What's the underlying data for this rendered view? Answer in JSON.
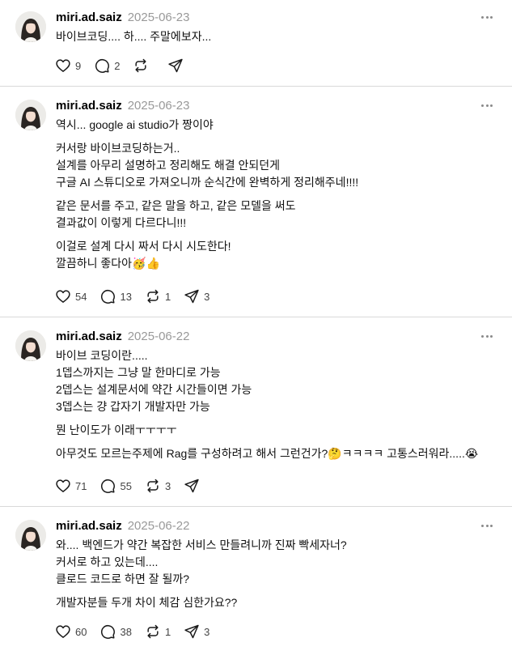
{
  "posts": [
    {
      "username": "miri.ad.saiz",
      "date": "2025-06-23",
      "paragraphs": [
        "바이브코딩.... 하.... 주말에보자..."
      ],
      "likes": "9",
      "replies": "2",
      "reposts": "",
      "shares": ""
    },
    {
      "username": "miri.ad.saiz",
      "date": "2025-06-23",
      "paragraphs": [
        "역시... google ai studio가 짱이야",
        "커서랑 바이브코딩하는거..\n설계를 아무리 설명하고 정리해도 해결 안되던게\n구글 AI 스튜디오로 가져오니까 순식간에 완벽하게 정리해주네!!!!",
        "같은 문서를 주고, 같은 말을 하고, 같은 모델을 써도\n결과값이 이렇게 다르다니!!!",
        "이걸로 설계 다시 짜서 다시 시도한다!\n깔끔하니 좋다아🥳👍"
      ],
      "likes": "54",
      "replies": "13",
      "reposts": "1",
      "shares": "3"
    },
    {
      "username": "miri.ad.saiz",
      "date": "2025-06-22",
      "paragraphs": [
        "바이브 코딩이란.....\n1뎁스까지는 그냥 말 한마디로 가능\n2뎁스는 설계문서에 약간 시간들이면 가능\n3뎁스는 걍 갑자기 개발자만 가능",
        "뭔 난이도가 이래ㅜㅜㅜㅜ",
        "아무것도 모르는주제에 Rag를 구성하려고 해서 그런건가?🤔ㅋㅋㅋㅋ 고통스러워라.....😭"
      ],
      "likes": "71",
      "replies": "55",
      "reposts": "3",
      "shares": ""
    },
    {
      "username": "miri.ad.saiz",
      "date": "2025-06-22",
      "paragraphs": [
        "와.... 백엔드가 약간 복잡한 서비스 만들려니까 진짜 빡세자너?\n커서로 하고 있는데....\n클로드 코드로 하면 잘 될까?",
        "개발자분들 두개 차이 체감 심한가요??"
      ],
      "likes": "60",
      "replies": "38",
      "reposts": "1",
      "shares": "3"
    }
  ]
}
